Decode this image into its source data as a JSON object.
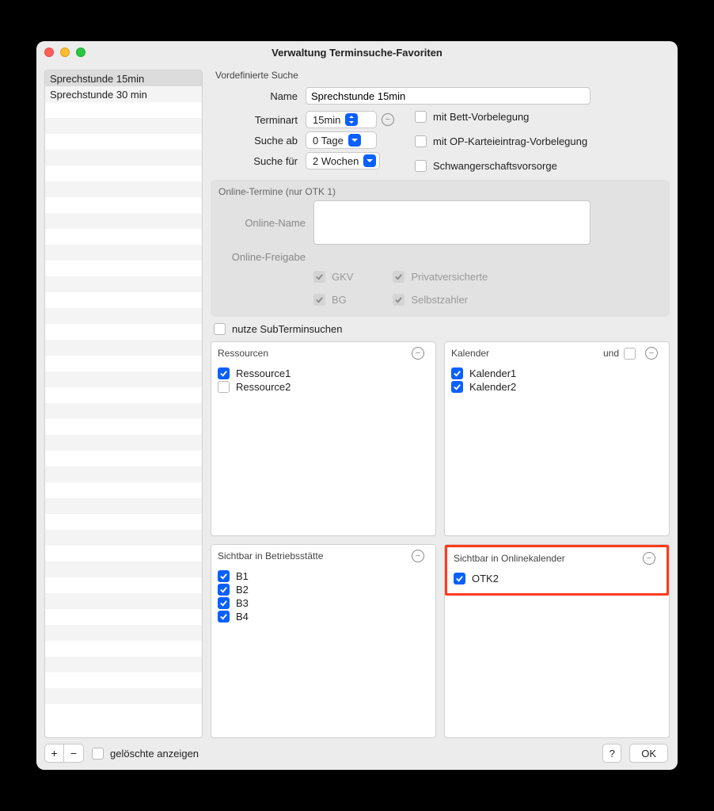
{
  "window": {
    "title": "Verwaltung Terminsuche-Favoriten"
  },
  "sidebar": {
    "items": [
      "Sprechstunde 15min",
      "Sprechstunde 30 min"
    ],
    "selected": 0
  },
  "predef": {
    "section": "Vordefinierte Suche",
    "name_label": "Name",
    "name_value": "Sprechstunde 15min",
    "terminart_label": "Terminart",
    "terminart_value": "15min",
    "sucheab_label": "Suche ab",
    "sucheab_value": "0 Tage",
    "suchefuer_label": "Suche für",
    "suchefuer_value": "2 Wochen",
    "bett_label": "mit Bett-Vorbelegung",
    "op_label": "mit OP-Karteieintrag-Vorbelegung",
    "schwanger_label": "Schwangerschaftsvorsorge"
  },
  "online": {
    "section": "Online-Termine (nur OTK 1)",
    "name_label": "Online-Name",
    "freigabe_label": "Online-Freigabe",
    "gkv": "GKV",
    "bg": "BG",
    "privat": "Privatversicherte",
    "selbst": "Selbstzahler"
  },
  "subsearch": "nutze SubTerminsuchen",
  "resources": {
    "title": "Ressourcen",
    "items": [
      {
        "label": "Ressource1",
        "checked": true
      },
      {
        "label": "Ressource2",
        "checked": false
      }
    ]
  },
  "calendars": {
    "title": "Kalender",
    "and_label": "und",
    "items": [
      {
        "label": "Kalender1",
        "checked": true
      },
      {
        "label": "Kalender2",
        "checked": true
      }
    ]
  },
  "bs": {
    "title": "Sichtbar in Betriebsstätte",
    "items": [
      {
        "label": "B1",
        "checked": true
      },
      {
        "label": "B2",
        "checked": true
      },
      {
        "label": "B3",
        "checked": true
      },
      {
        "label": "B4",
        "checked": true
      }
    ]
  },
  "okal": {
    "title": "Sichtbar in Onlinekalender",
    "items": [
      {
        "label": "OTK2",
        "checked": true
      }
    ]
  },
  "footer": {
    "geloeschte": "gelöschte anzeigen",
    "help": "?",
    "ok": "OK"
  }
}
